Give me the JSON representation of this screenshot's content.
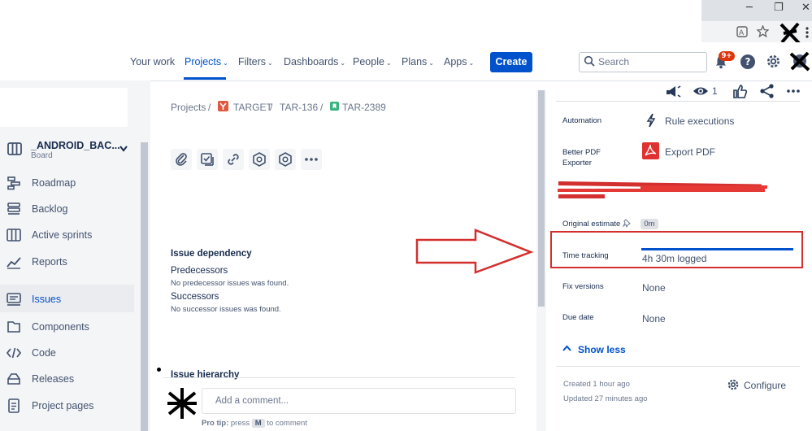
{
  "browser": {
    "minimize": "─",
    "restore": "❐",
    "close": "✕"
  },
  "topnav": {
    "items": [
      {
        "label": "Your work",
        "dropdown": false
      },
      {
        "label": "Projects",
        "dropdown": true
      },
      {
        "label": "Filters",
        "dropdown": true
      },
      {
        "label": "Dashboards",
        "dropdown": true
      },
      {
        "label": "People",
        "dropdown": true
      },
      {
        "label": "Plans",
        "dropdown": true
      },
      {
        "label": "Apps",
        "dropdown": true
      }
    ],
    "caret": "⌄",
    "create_label": "Create",
    "search_placeholder": "Search",
    "notification_badge": "9+",
    "help_glyph": "?"
  },
  "sidebar": {
    "project_name": "_ANDROID_BAC...",
    "project_type": "Board",
    "items": [
      {
        "label": "Roadmap",
        "icon": "roadmap-icon"
      },
      {
        "label": "Backlog",
        "icon": "backlog-icon"
      },
      {
        "label": "Active sprints",
        "icon": "sprint-board-icon"
      },
      {
        "label": "Reports",
        "icon": "reports-icon"
      },
      {
        "label": "Issues",
        "icon": "issues-icon",
        "active": true
      },
      {
        "label": "Components",
        "icon": "components-icon"
      },
      {
        "label": "Code",
        "icon": "code-icon"
      },
      {
        "label": "Releases",
        "icon": "releases-icon"
      },
      {
        "label": "Project pages",
        "icon": "project-pages-icon"
      }
    ]
  },
  "breadcrumb": {
    "projects": "Projects",
    "separator": "/",
    "project": "TARGET",
    "parent": "TAR-136",
    "issue": "TAR-2389"
  },
  "dependency": {
    "title": "Issue dependency",
    "predecessors_label": "Predecessors",
    "predecessors_empty": "No predecessor issues was found.",
    "successors_label": "Successors",
    "successors_empty": "No successor issues was found."
  },
  "hierarchy": {
    "title": "Issue hierarchy"
  },
  "comment": {
    "placeholder": "Add a comment...",
    "protip_prefix": "Pro tip:",
    "protip_press": "press",
    "protip_key": "M",
    "protip_suffix": "to comment"
  },
  "details": {
    "watch_count": "1",
    "automation_label": "Automation",
    "automation_value": "Rule executions",
    "pdf_label": "Better PDF Exporter",
    "pdf_value": "Export PDF",
    "estimate_label": "Original estimate",
    "estimate_value": "0m",
    "tracking_label": "Time tracking",
    "tracking_value": "4h 30m logged",
    "tracking_progress": 1.0,
    "fix_label": "Fix versions",
    "fix_value": "None",
    "due_label": "Due date",
    "due_value": "None",
    "show_less": "Show less",
    "created": "Created 1 hour ago",
    "updated": "Updated 27 minutes ago",
    "configure": "Configure"
  },
  "colors": {
    "accent": "#0052cc",
    "annotation_red": "#d32f2f"
  }
}
